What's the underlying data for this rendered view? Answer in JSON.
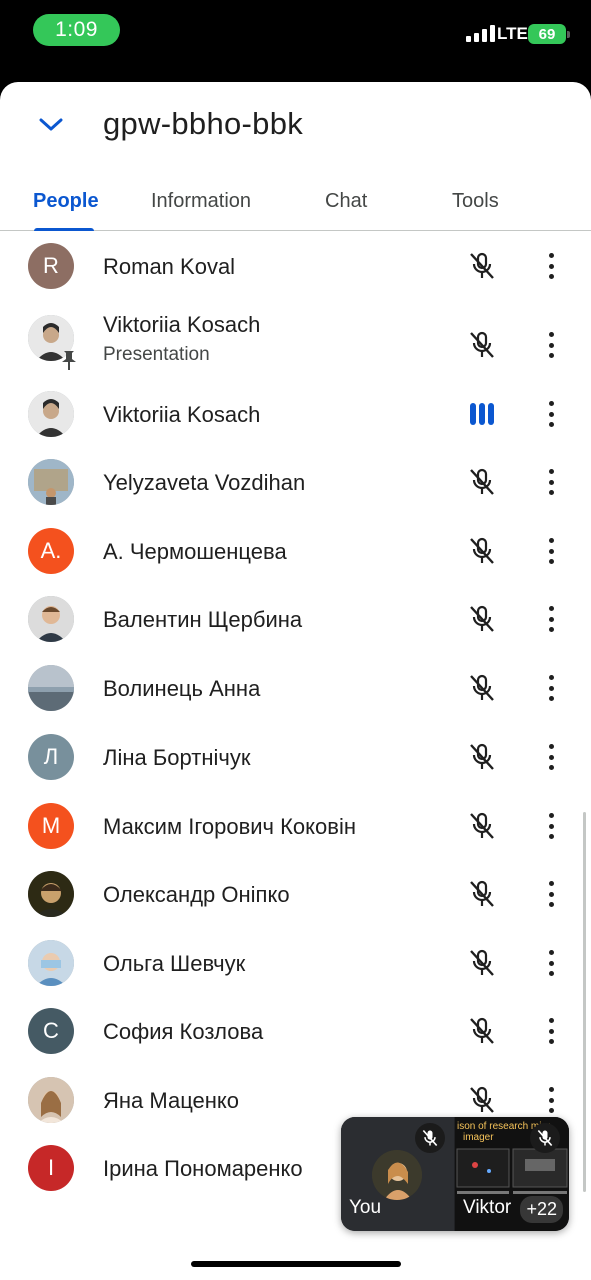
{
  "status_bar": {
    "time": "1:09",
    "network": "LTE",
    "battery": "69"
  },
  "header": {
    "meeting_code": "gpw-bbho-bbk",
    "collapse_icon": "chevron-down-icon"
  },
  "tabs": [
    {
      "label": "People",
      "active": true
    },
    {
      "label": "Information",
      "active": false
    },
    {
      "label": "Chat",
      "active": false
    },
    {
      "label": "Tools",
      "active": false
    }
  ],
  "participants": [
    {
      "name": "Roman Koval",
      "initial": "R",
      "avatar_color": "#8d6e63",
      "mic": "muted"
    },
    {
      "name": "Viktoriia Kosach",
      "subtitle": "Presentation",
      "avatar": "photo",
      "pinned": true,
      "mic": "muted"
    },
    {
      "name": "Viktoriia Kosach",
      "avatar": "photo",
      "mic": "speaking"
    },
    {
      "name": "Yelyzaveta Vozdihan",
      "avatar": "photo",
      "mic": "muted"
    },
    {
      "name": "А. Чермошенцева",
      "initial": "А.",
      "avatar_color": "#f4511e",
      "mic": "muted"
    },
    {
      "name": "Валентин Щербина",
      "avatar": "photo",
      "mic": "muted"
    },
    {
      "name": "Волинець Анна",
      "avatar": "photo",
      "mic": "muted"
    },
    {
      "name": "Ліна Бортнічук",
      "initial": "Л",
      "avatar_color": "#78909c",
      "mic": "muted"
    },
    {
      "name": "Максим Ігорович Коковін",
      "initial": "М",
      "avatar_color": "#f4511e",
      "mic": "muted"
    },
    {
      "name": "Олександр Оніпко",
      "avatar": "photo",
      "mic": "muted"
    },
    {
      "name": "Ольга Шевчук",
      "avatar": "photo",
      "mic": "muted"
    },
    {
      "name": "София Козлова",
      "initial": "С",
      "avatar_color": "#455a64",
      "mic": "muted"
    },
    {
      "name": "Яна Маценко",
      "avatar": "photo",
      "mic": "muted"
    },
    {
      "name": "Ірина Пономаренко",
      "initial": "І",
      "avatar_color": "#c62828",
      "mic": "hidden"
    }
  ],
  "pip": {
    "self_label": "You",
    "screen_label": "Viktor",
    "screen_title": "ison of research micr",
    "screen_subtitle": "imager",
    "others_count": "+22"
  },
  "colors": {
    "accent": "#0b57d0",
    "text": "#1f1f1f",
    "speaking": "#0b57d0",
    "status_green": "#34c759"
  }
}
